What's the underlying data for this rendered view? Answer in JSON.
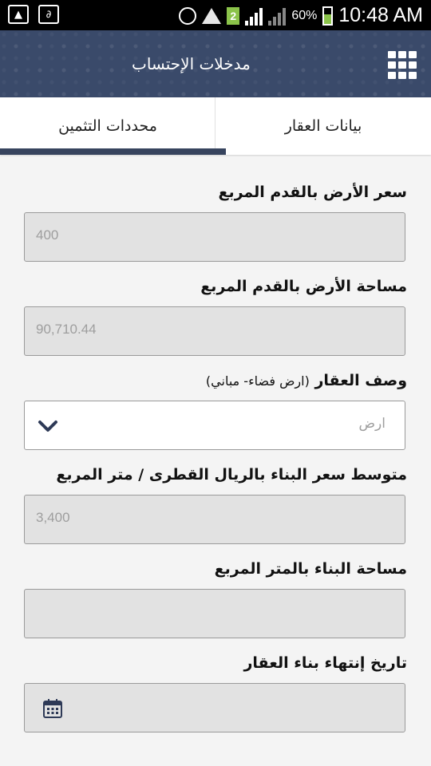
{
  "status_bar": {
    "battery_percent": "60%",
    "time": "10:48 AM",
    "sim_badge": "2"
  },
  "header": {
    "title": "مدخلات الإحتساب",
    "menu_icon": "grid-menu-icon"
  },
  "tabs": [
    {
      "label": "بيانات العقار",
      "selected": false
    },
    {
      "label": "محددات التثمين",
      "selected": true
    }
  ],
  "form": {
    "land_price": {
      "label": "سعر الأرض بالقدم المربع",
      "value": "400"
    },
    "land_area": {
      "label": "مساحة الأرض بالقدم المربع",
      "value": "90,710.44"
    },
    "property_desc": {
      "label": "وصف العقار",
      "hint": "(ارض فضاء- مباني)",
      "value": "ارض"
    },
    "avg_build_price": {
      "label": "متوسط سعر البناء بالريال القطرى / متر المربع",
      "value": "3,400"
    },
    "build_area": {
      "label": "مساحة البناء بالمتر المربع",
      "value": ""
    },
    "completion_date": {
      "label": "تاريخ إنتهاء بناء العقار",
      "value": ""
    }
  },
  "colors": {
    "header_bg": "#3a4a6a",
    "tab_underline": "#37445e",
    "field_bg": "#e2e2e2"
  }
}
